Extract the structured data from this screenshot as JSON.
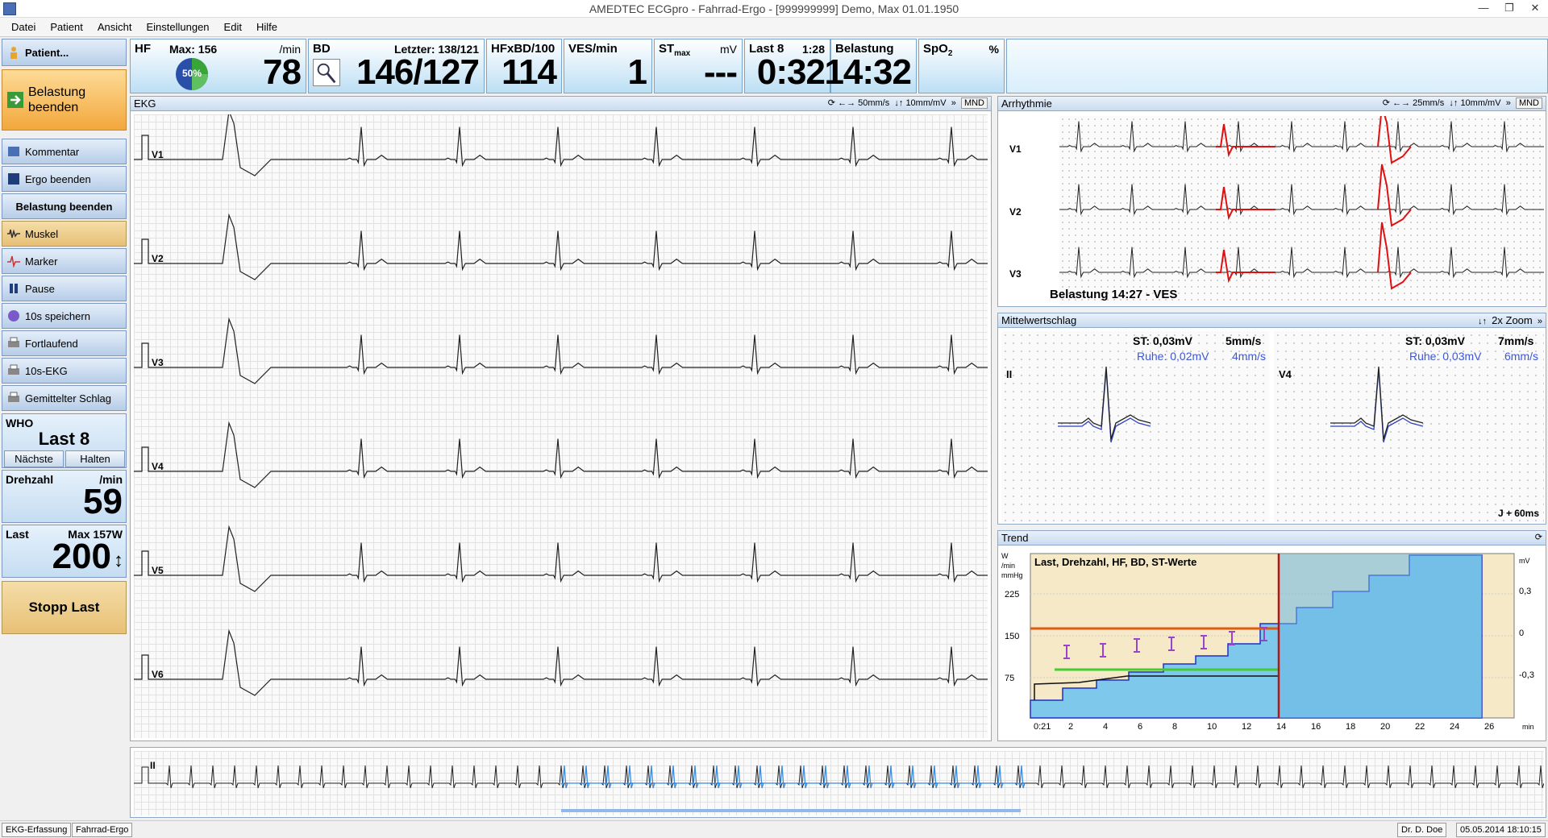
{
  "window": {
    "title": "AMEDTEC ECGpro   -   Fahrrad-Ergo   -   [999999999] Demo, Max 01.01.1950"
  },
  "menu": [
    "Datei",
    "Patient",
    "Ansicht",
    "Einstellungen",
    "Edit",
    "Hilfe"
  ],
  "left": {
    "patient": "Patient...",
    "belastung_top": "Belastung beenden",
    "kommentar": "Kommentar",
    "ergo_beenden": "Ergo beenden",
    "belastung_beenden": "Belastung beenden",
    "muskel": "Muskel",
    "marker": "Marker",
    "pause": "Pause",
    "speichern": "10s speichern",
    "fortlaufend": "Fortlaufend",
    "ekg10": "10s-EKG",
    "gemittelt": "Gemittelter Schlag",
    "who_label": "WHO",
    "who_stage": "Last 8",
    "naechste": "Nächste",
    "halten": "Halten",
    "drehzahl_label": "Drehzahl",
    "drehzahl_unit": "/min",
    "drehzahl_value": "59",
    "last_label": "Last",
    "last_max": "Max 157W",
    "last_value": "200",
    "stopp": "Stopp Last"
  },
  "vitals": {
    "hf_label": "HF",
    "hf_max": "Max: 156",
    "hf_unit": "/min",
    "hf_value": "78",
    "hf_pct": "50%",
    "bd_label": "BD",
    "bd_last": "Letzter: 138/121",
    "bd_value": "146/127",
    "hfxbd_label": "HFxBD/100",
    "hfxbd_value": "114",
    "ves_label": "VES/min",
    "ves_value": "1",
    "st_label": "ST",
    "st_sub": "max",
    "st_unit": "mV",
    "st_value": "---",
    "last_label": "Last 8",
    "last_time": "1:28",
    "last_value": "0:32",
    "belastung_label": "Belastung",
    "belastung_value": "14:32",
    "spo2_label": "SpO",
    "spo2_sub": "2",
    "spo2_unit": "%"
  },
  "ekg": {
    "title": "EKG",
    "speed": "50mm/s",
    "gain": "10mm/mV",
    "mnd": "MND",
    "leads": [
      "V1",
      "V2",
      "V3",
      "V4",
      "V5",
      "V6"
    ]
  },
  "arr": {
    "title": "Arrhythmie",
    "speed": "25mm/s",
    "gain": "10mm/mV",
    "mnd": "MND",
    "leads": [
      "V1",
      "V2",
      "V3"
    ],
    "caption": "Belastung 14:27 - VES"
  },
  "mittel": {
    "title": "Mittelwertschlag",
    "zoom": "2x Zoom",
    "left": {
      "lead": "II",
      "st": "ST:  0,03mV",
      "speed": "5mm/s",
      "ruhe": "Ruhe: 0,02mV",
      "ruhe_speed": "4mm/s"
    },
    "right": {
      "lead": "V4",
      "st": "ST:  0,03mV",
      "speed": "7mm/s",
      "ruhe": "Ruhe: 0,03mV",
      "ruhe_speed": "6mm/s"
    },
    "jpoint": "J + 60ms"
  },
  "trend": {
    "title": "Trend",
    "chart_title": "Last, Drehzahl, HF, BD, ST-Werte",
    "yunits": [
      "W",
      "/min",
      "mmHg"
    ],
    "yticks": [
      "225",
      "150",
      "75"
    ],
    "rticks": [
      "0,3",
      "0",
      "-0,3"
    ],
    "runit": "mV",
    "xticks": [
      "0:21",
      "2",
      "4",
      "6",
      "8",
      "10",
      "12",
      "14",
      "16",
      "18",
      "20",
      "22",
      "24",
      "26"
    ],
    "xunit": "min"
  },
  "rhythm": {
    "lead": "II"
  },
  "status": {
    "left1": "EKG-Erfassung",
    "left2": "Fahrrad-Ergo",
    "user": "Dr. D. Doe",
    "datetime": "05.05.2014 18:10:15"
  }
}
